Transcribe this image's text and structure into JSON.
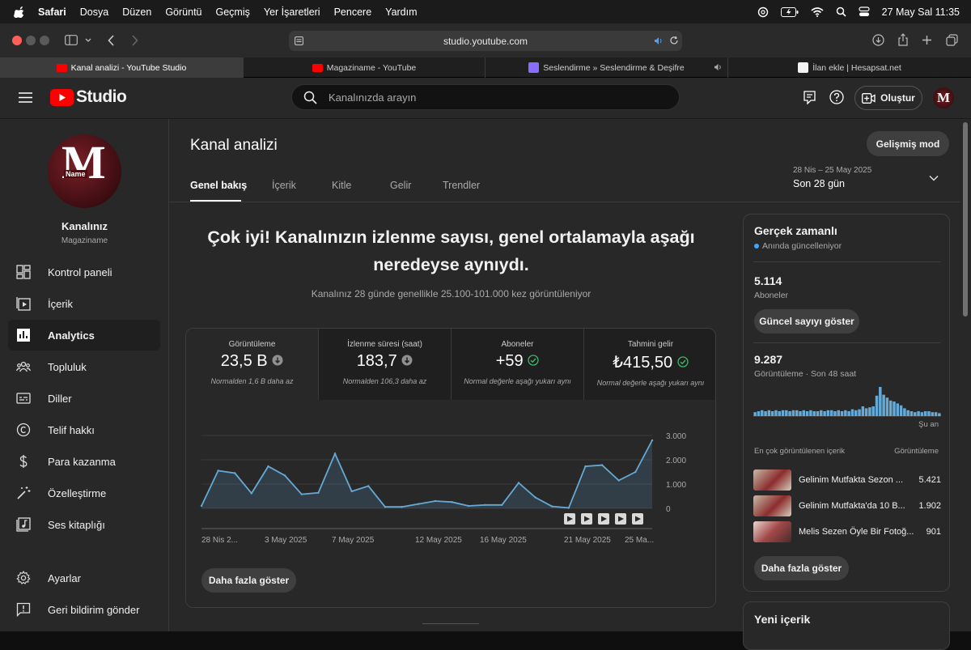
{
  "menubar": {
    "app": "Safari",
    "items": [
      "Dosya",
      "Düzen",
      "Görüntü",
      "Geçmiş",
      "Yer İşaretleri",
      "Pencere",
      "Yardım"
    ],
    "datetime": "27 May Sal  11:35"
  },
  "browser": {
    "url": "studio.youtube.com",
    "tabs": [
      {
        "label": "Kanal analizi - YouTube Studio",
        "favicon_color": "#ff0000"
      },
      {
        "label": "Magaziname - YouTube",
        "favicon_color": "#ff0000"
      },
      {
        "label": "Seslendirme » Seslendirme & Deşifre",
        "favicon_color": "#8a6cff"
      },
      {
        "label": "İlan ekle | Hesapsat.net",
        "favicon_color": "#f3f3f3"
      }
    ]
  },
  "header": {
    "logo_text": "Studio",
    "search_placeholder": "Kanalınızda arayın",
    "create_label": "Oluştur",
    "avatar_letter": "M"
  },
  "channel": {
    "title": "Kanalınız",
    "name": "Magaziname",
    "logo_letter": "M",
    "logo_tag": "Name"
  },
  "sidebar": {
    "items": [
      {
        "label": "Kontrol paneli",
        "icon": "dashboard-icon"
      },
      {
        "label": "İçerik",
        "icon": "content-icon"
      },
      {
        "label": "Analytics",
        "icon": "analytics-icon",
        "active": true
      },
      {
        "label": "Topluluk",
        "icon": "community-icon"
      },
      {
        "label": "Diller",
        "icon": "subtitles-icon"
      },
      {
        "label": "Telif hakkı",
        "icon": "copyright-icon"
      },
      {
        "label": "Para kazanma",
        "icon": "dollar-icon"
      },
      {
        "label": "Özelleştirme",
        "icon": "magic-wand-icon"
      },
      {
        "label": "Ses kitaplığı",
        "icon": "audio-library-icon"
      }
    ],
    "bottom": [
      {
        "label": "Ayarlar",
        "icon": "gear-icon"
      },
      {
        "label": "Geri bildirim gönder",
        "icon": "feedback-icon"
      }
    ]
  },
  "page": {
    "title": "Kanal analizi",
    "advanced_mode": "Gelişmiş mod",
    "tabs": [
      "Genel bakış",
      "İçerik",
      "Kitle",
      "Gelir",
      "Trendler"
    ],
    "active_tab": 0,
    "date_range": "28 Nis – 25 May 2025",
    "date_label": "Son 28 gün",
    "headline_line1": "Çok iyi! Kanalınızın izlenme sayısı, genel ortalamayla aşağı",
    "headline_line2": "neredeyse aynıydı.",
    "subline": "Kanalınız 28 günde genellikle 25.100-101.000 kez görüntüleniyor",
    "show_more": "Daha fazla göster"
  },
  "metrics": [
    {
      "title": "Görüntüleme",
      "value": "23,5 B",
      "status": "down",
      "note": "Normalden 1,6 B daha az"
    },
    {
      "title": "İzlenme süresi (saat)",
      "value": "183,7",
      "status": "down",
      "note": "Normalden 106,3 daha az"
    },
    {
      "title": "Aboneler",
      "value": "+59",
      "status": "ok",
      "note": "Normal değerle aşağı yukarı aynı"
    },
    {
      "title": "Tahmini gelir",
      "value": "₺415,50",
      "status": "ok",
      "note": "Normal değerle aşağı yukarı aynı"
    }
  ],
  "chart_data": {
    "type": "area",
    "x_ticks": [
      "28 Nis 2...",
      "3 May 2025",
      "7 May 2025",
      "12 May 2025",
      "16 May 2025",
      "21 May 2025",
      "25 Ma..."
    ],
    "y_ticks": [
      "3.000",
      "2.000",
      "1.000",
      "0"
    ],
    "ylim": [
      0,
      3000
    ],
    "values": [
      100,
      1550,
      1450,
      620,
      1730,
      1350,
      580,
      640,
      2250,
      700,
      920,
      60,
      60,
      180,
      300,
      260,
      100,
      140,
      140,
      1050,
      450,
      80,
      20,
      1730,
      1780,
      1150,
      1500,
      2800
    ],
    "color": "#65a9d6"
  },
  "realtime": {
    "title": "Gerçek zamanlı",
    "status": "Anında güncelleniyor",
    "subscribers": "5.114",
    "subscribers_label": "Aboneler",
    "live_count_btn": "Güncel sayıyı göster",
    "views": "9.287",
    "views_label": "Görüntüleme · Son 48 saat",
    "now_label": "Şu an",
    "bars": [
      4,
      5,
      6,
      5,
      6,
      5,
      6,
      5,
      6,
      6,
      5,
      6,
      6,
      5,
      6,
      5,
      6,
      5,
      5,
      6,
      5,
      6,
      6,
      5,
      6,
      5,
      6,
      5,
      7,
      6,
      7,
      10,
      8,
      9,
      10,
      21,
      30,
      22,
      19,
      16,
      15,
      13,
      11,
      8,
      6,
      5,
      4,
      5,
      4,
      5,
      5,
      4,
      4,
      3
    ],
    "top_header": "En çok görüntülenen içerik",
    "top_value_header": "Görüntüleme",
    "top": [
      {
        "title": "Gelinim Mutfakta Sezon ...",
        "views": "5.421"
      },
      {
        "title": "Gelinim Mutfakta'da 10 B...",
        "views": "1.902"
      },
      {
        "title": "Melis Sezen Öyle Bir Fotoğ...",
        "views": "901"
      }
    ],
    "show_more": "Daha fazla göster"
  },
  "new_content": {
    "title": "Yeni içerik"
  }
}
